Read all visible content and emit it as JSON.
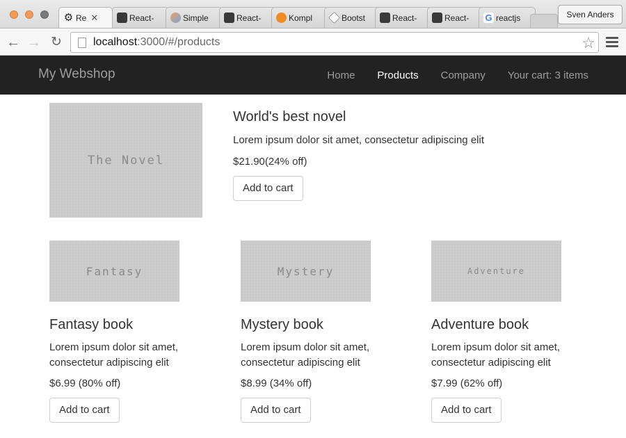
{
  "browser": {
    "tabs": [
      {
        "label": "Re",
        "icon": "gear-icon",
        "active": true
      },
      {
        "label": "React-",
        "icon": "react-icon"
      },
      {
        "label": "Simple",
        "icon": "simple-icon"
      },
      {
        "label": "React-",
        "icon": "react-icon"
      },
      {
        "label": "Kompl",
        "icon": "orange-icon"
      },
      {
        "label": "Bootst",
        "icon": "bootstrap-icon"
      },
      {
        "label": "React-",
        "icon": "react-icon"
      },
      {
        "label": "React-",
        "icon": "react-icon"
      },
      {
        "label": "reactjs",
        "icon": "google-icon"
      }
    ],
    "profile": "Sven Anders",
    "url_host": "localhost",
    "url_path": ":3000/#/products"
  },
  "navbar": {
    "brand": "My Webshop",
    "links": [
      "Home",
      "Products",
      "Company"
    ],
    "active": "Products",
    "cart": "Your cart: 3 items"
  },
  "featured": {
    "image_text": "The Novel",
    "title": "World's best novel",
    "description": "Lorem ipsum dolor sit amet, consectetur adipiscing elit",
    "price": "$21.90(24% off)",
    "button": "Add to cart"
  },
  "products": [
    {
      "image_text": "Fantasy",
      "title": "Fantasy book",
      "description_line1": "Lorem ipsum dolor sit amet,",
      "description_line2": "consectetur adipiscing elit",
      "price": "$6.99 (80% off)",
      "button": "Add to cart"
    },
    {
      "image_text": "Mystery",
      "title": "Mystery book",
      "description_line1": "Lorem ipsum dolor sit amet,",
      "description_line2": "consectetur adipiscing elit",
      "price": "$8.99 (34% off)",
      "button": "Add to cart"
    },
    {
      "image_text": "Adventure",
      "title": "Adventure book",
      "description_line1": "Lorem ipsum dolor sit amet,",
      "description_line2": "consectetur adipiscing elit",
      "price": "$7.99 (62% off)",
      "button": "Add to cart"
    }
  ],
  "colors": {
    "navbar_bg": "#222222",
    "nav_text": "#9d9d9d",
    "nav_active": "#ffffff",
    "placeholder_bg": "#cccccc"
  }
}
